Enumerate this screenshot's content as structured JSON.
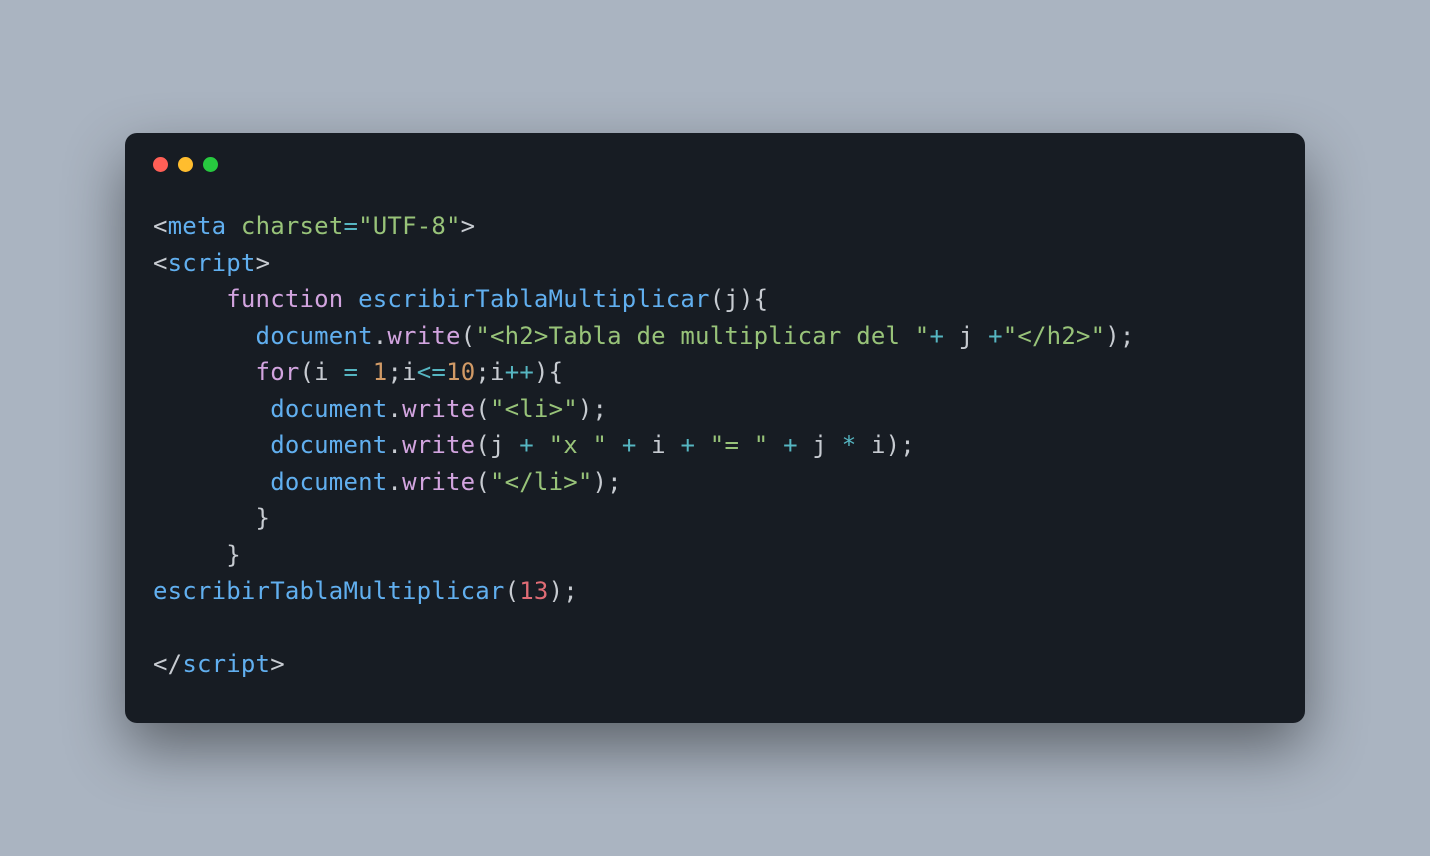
{
  "window": {
    "dots": {
      "red": "#ff5f56",
      "yellow": "#ffbd2e",
      "green": "#27c93f"
    }
  },
  "code": {
    "line1": {
      "bracket_open": "<",
      "tag_meta": "meta",
      "sp1": " ",
      "attr_charset": "charset",
      "eq": "=",
      "val_utf8": "\"UTF-8\"",
      "bracket_close": ">"
    },
    "line2": {
      "bracket_open": "<",
      "tag_script": "script",
      "bracket_close": ">"
    },
    "line3": {
      "indent": "     ",
      "kw_function": "function",
      "sp": " ",
      "fn_name": "escribirTablaMultiplicar",
      "paren_open": "(",
      "param_j": "j",
      "paren_close_brace": "){"
    },
    "line4": {
      "indent": "       ",
      "obj_document": "document",
      "dot": ".",
      "method_write": "write",
      "paren_open": "(",
      "str_h2_open": "\"<h2>Tabla de multiplicar del \"",
      "plus1": "+ ",
      "var_j": "j ",
      "plus2": "+",
      "str_h2_close": "\"</h2>\"",
      "close": ");"
    },
    "line5": {
      "indent": "       ",
      "kw_for": "for",
      "paren_open": "(",
      "var_i1": "i ",
      "op_eq": "= ",
      "num_1": "1",
      "semi1": ";",
      "var_i2": "i",
      "op_le": "<=",
      "num_10": "10",
      "semi2": ";",
      "var_i3": "i",
      "op_pp": "++",
      "close": "){"
    },
    "line6": {
      "indent": "        ",
      "obj_document": "document",
      "dot": ".",
      "method_write": "write",
      "paren_open": "(",
      "str_li_open": "\"<li>\"",
      "close": ");"
    },
    "line7": {
      "indent": "        ",
      "obj_document": "document",
      "dot": ".",
      "method_write": "write",
      "paren_open": "(",
      "var_j1": "j ",
      "op_plus1": "+ ",
      "str_x": "\"x \"",
      "sp1": " ",
      "op_plus2": "+ ",
      "var_i": "i ",
      "op_plus3": "+ ",
      "str_eq": "\"= \"",
      "sp2": " ",
      "op_plus4": "+ ",
      "var_j2": "j ",
      "op_star": "* ",
      "var_i2": "i",
      "close": ");"
    },
    "line8": {
      "indent": "        ",
      "obj_document": "document",
      "dot": ".",
      "method_write": "write",
      "paren_open": "(",
      "str_li_close": "\"</li>\"",
      "close": ");"
    },
    "line9": {
      "indent": "       ",
      "brace_close": "}"
    },
    "line10": {
      "indent": "     ",
      "brace_close": "}"
    },
    "line11": {
      "fn_call": "escribirTablaMultiplicar",
      "paren_open": "(",
      "num_13": "13",
      "close": ");"
    },
    "line12_blank": "",
    "line13": {
      "bracket_open": "</",
      "tag_script": "script",
      "bracket_close": ">"
    }
  }
}
